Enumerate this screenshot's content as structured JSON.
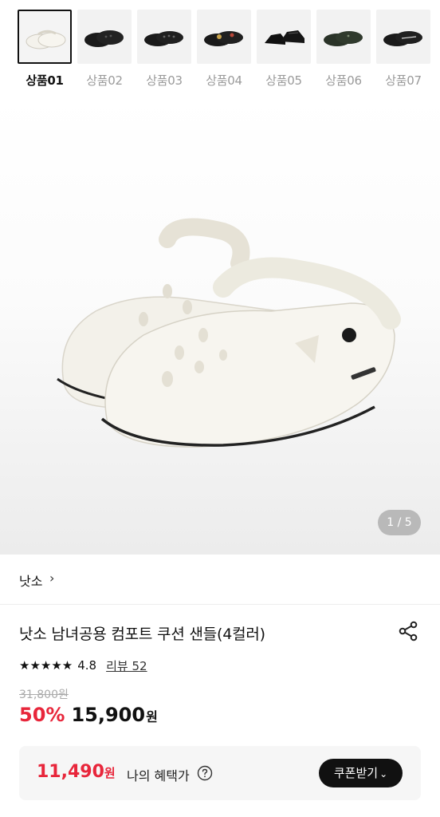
{
  "thumbnails": [
    {
      "label": "상품01",
      "color": "#f2f0ea",
      "selected": true
    },
    {
      "label": "상품02",
      "color": "#1a1a1a",
      "selected": false
    },
    {
      "label": "상품03",
      "color": "#1a1a1a",
      "selected": false
    },
    {
      "label": "상품04",
      "color": "#1a1a1a",
      "selected": false
    },
    {
      "label": "상품05",
      "color": "#111111",
      "selected": false
    },
    {
      "label": "상품06",
      "color": "#2a3328",
      "selected": false
    },
    {
      "label": "상품07",
      "color": "#1a1a1a",
      "selected": false
    }
  ],
  "hero": {
    "pager": "1 / 5"
  },
  "brand": {
    "name": "낫소",
    "chevron": "›"
  },
  "product": {
    "title": "낫소 남녀공용 컴포트 쿠션 샌들(4컬러)",
    "stars": "★★★★★",
    "rating": "4.8",
    "review_label": "리뷰 52",
    "original_price": "31,800원",
    "discount": "50%",
    "price": "15,900",
    "currency": "원"
  },
  "benefit": {
    "price": "11,490",
    "currency": "원",
    "label": "나의 혜택가",
    "coupon_button": "쿠폰받기",
    "coupon_chevron": "⌄"
  },
  "colors": {
    "accent_red": "#e8263b",
    "dark": "#111111"
  },
  "icons": {
    "share": "share-icon",
    "help": "question-circle-icon"
  }
}
